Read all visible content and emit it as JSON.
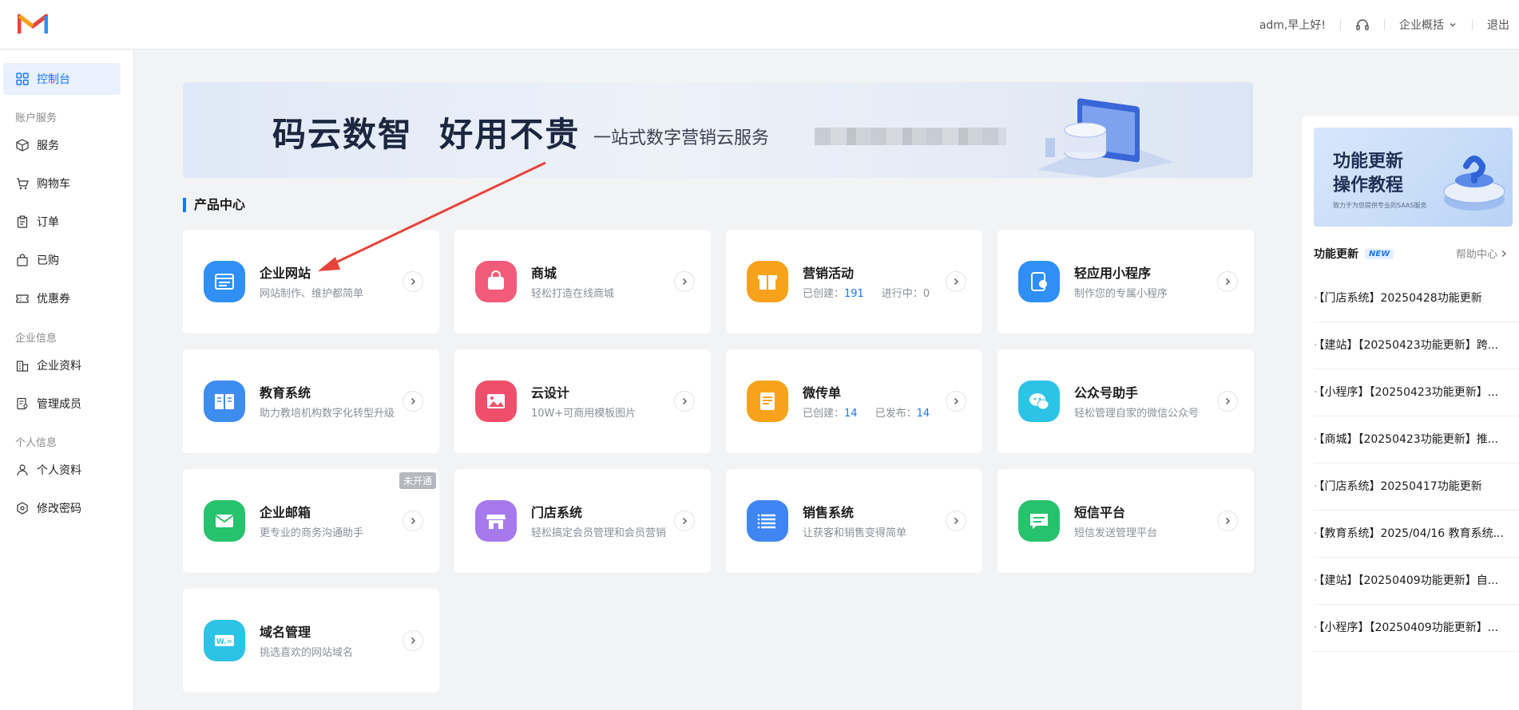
{
  "header": {
    "greeting": "adm,早上好!",
    "overview_label": "企业概括",
    "logout_label": "退出"
  },
  "sidebar": {
    "active": {
      "label": "控制台"
    },
    "groups": [
      {
        "title": "账户服务",
        "items": [
          {
            "label": "服务"
          },
          {
            "label": "购物车"
          },
          {
            "label": "订单"
          },
          {
            "label": "已购"
          },
          {
            "label": "优惠券"
          }
        ]
      },
      {
        "title": "企业信息",
        "items": [
          {
            "label": "企业资料"
          },
          {
            "label": "管理成员"
          }
        ]
      },
      {
        "title": "个人信息",
        "items": [
          {
            "label": "个人资料"
          },
          {
            "label": "修改密码"
          }
        ]
      }
    ]
  },
  "banner": {
    "headline": "码云数智  好用不贵",
    "subline": "一站式数字营销云服务"
  },
  "product_center": {
    "title": "产品中心",
    "cards": [
      {
        "title": "企业网站",
        "desc": "网站制作、维护都简单",
        "color": "#2f8ff5",
        "icon": "website-icon"
      },
      {
        "title": "商城",
        "desc": "轻松打造在线商城",
        "color": "#f25b7a",
        "icon": "shop-bag-icon"
      },
      {
        "title": "营销活动",
        "desc_created_label": "已创建：",
        "desc_created": "191",
        "desc_running_label": "进行中：",
        "desc_running": "0",
        "color": "#f7a21b",
        "icon": "gift-icon"
      },
      {
        "title": "轻应用小程序",
        "desc": "制作您的专属小程序",
        "color": "#2f8ff5",
        "icon": "mini-program-icon"
      },
      {
        "title": "教育系统",
        "desc": "助力教培机构数字化转型升级",
        "color": "#3d8cf0",
        "icon": "book-icon"
      },
      {
        "title": "云设计",
        "desc": "10W+可商用模板图片",
        "color": "#f04f6c",
        "icon": "image-icon"
      },
      {
        "title": "微传单",
        "desc_created_label": "已创建：",
        "desc_created": "14",
        "desc_running_label": "已发布：",
        "desc_running": "14",
        "color": "#f7a21b",
        "icon": "flyer-icon"
      },
      {
        "title": "公众号助手",
        "desc": "轻松管理自家的微信公众号",
        "color": "#2cc3e6",
        "icon": "wechat-icon"
      },
      {
        "title": "企业邮箱",
        "desc": "更专业的商务沟通助手",
        "color": "#27c26c",
        "icon": "mail-icon",
        "tag": "未开通"
      },
      {
        "title": "门店系统",
        "desc": "轻松搞定会员管理和会员营销",
        "color": "#a779ee",
        "icon": "store-icon"
      },
      {
        "title": "销售系统",
        "desc": "让获客和销售变得简单",
        "color": "#3f86f2",
        "icon": "list-icon"
      },
      {
        "title": "短信平台",
        "desc": "短信发送管理平台",
        "color": "#27c26c",
        "icon": "sms-icon"
      },
      {
        "title": "域名管理",
        "desc": "挑选喜欢的网站域名",
        "color": "#2cc3e6",
        "icon": "domain-icon"
      }
    ]
  },
  "right_panel": {
    "promo_line1": "功能更新",
    "promo_line2": "操作教程",
    "promo_small": "致力于为您提供专业的SAAS服务",
    "updates_title": "功能更新",
    "new_badge": "NEW",
    "help_label": "帮助中心",
    "updates": [
      "【门店系统】20250428功能更新",
      "【建站】【20250423功能更新】跨...",
      "【小程序】【20250423功能更新】...",
      "【商城】【20250423功能更新】推...",
      "【门店系统】20250417功能更新",
      "【教育系统】2025/04/16 教育系统...",
      "【建站】【20250409功能更新】自...",
      "【小程序】【20250409功能更新】..."
    ]
  },
  "colors": {
    "accent": "#1677ff",
    "annotation_arrow": "#e8433a"
  }
}
